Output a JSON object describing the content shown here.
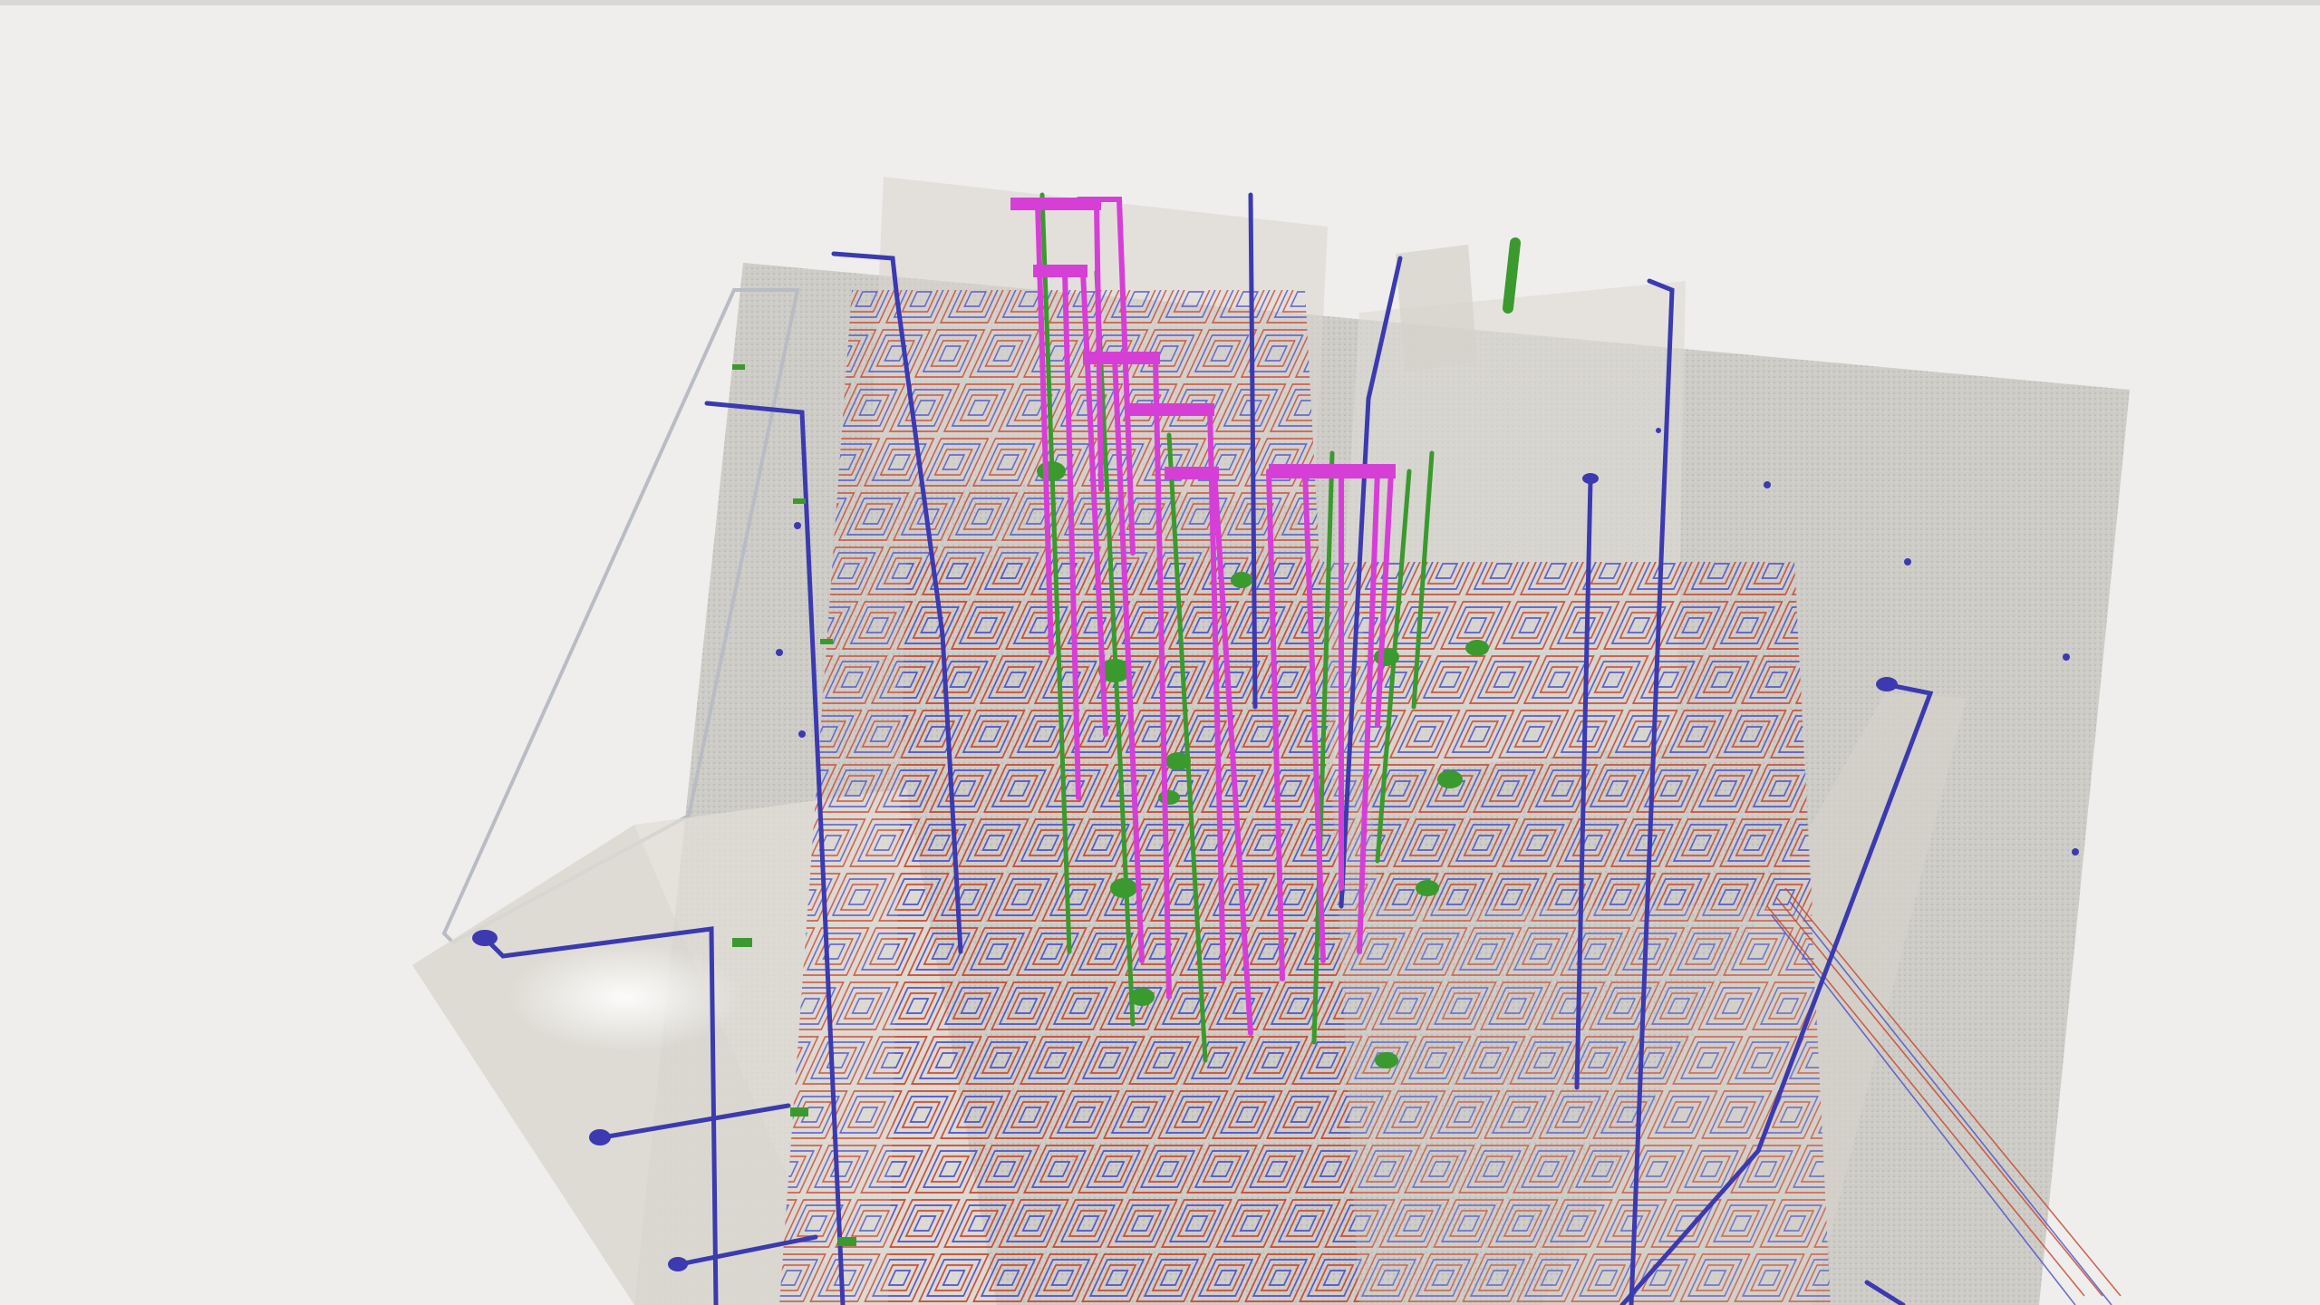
{
  "scene": {
    "colors": {
      "background": "#efeeec",
      "ground": "#b9b7b2",
      "walls": "#d8d4cd",
      "supply_pipes": "#3b3ab0",
      "heating_red": "#c9442c",
      "heating_blue": "#4a4fc8",
      "risers_magenta": "#d63fd6",
      "drain_green": "#3a9a2e"
    }
  }
}
